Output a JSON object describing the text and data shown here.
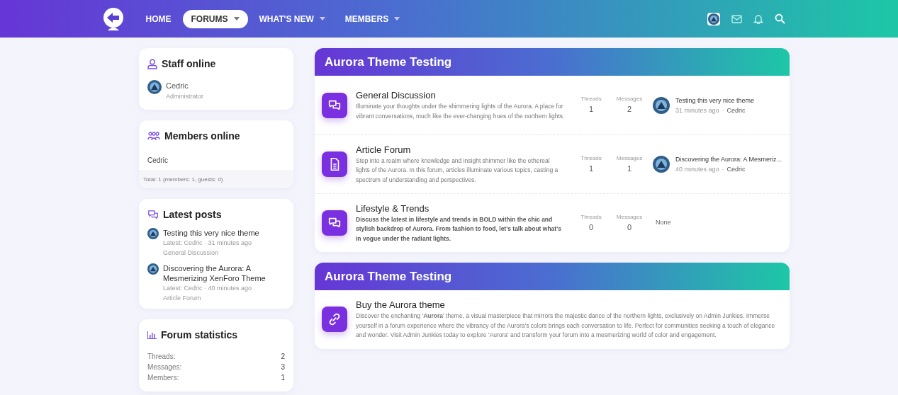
{
  "nav": {
    "items": [
      {
        "label": "HOME",
        "selected": false,
        "dropdown": false
      },
      {
        "label": "FORUMS",
        "selected": true,
        "dropdown": true
      },
      {
        "label": "WHAT'S NEW",
        "selected": false,
        "dropdown": true
      },
      {
        "label": "MEMBERS",
        "selected": false,
        "dropdown": true
      }
    ]
  },
  "sidebar": {
    "staff": {
      "title": "Staff online",
      "members": [
        {
          "name": "Cedric",
          "role": "Administrator"
        }
      ]
    },
    "online": {
      "title": "Members online",
      "names": "Cedric",
      "total": "Total: 1 (members: 1, guests: 0)"
    },
    "latest": {
      "title": "Latest posts",
      "posts": [
        {
          "title": "Testing this very nice theme",
          "meta": "Latest: Cedric · 31 minutes ago",
          "forum": "General Discussion"
        },
        {
          "title": "Discovering the Aurora: A Mesmerizing XenForo Theme",
          "meta": "Latest: Cedric · 40 minutes ago",
          "forum": "Article Forum"
        }
      ]
    },
    "stats": {
      "title": "Forum statistics",
      "rows": [
        {
          "label": "Threads:",
          "value": "2"
        },
        {
          "label": "Messages:",
          "value": "3"
        },
        {
          "label": "Members:",
          "value": "1"
        }
      ]
    }
  },
  "categories": [
    {
      "title": "Aurora Theme Testing",
      "nodes": [
        {
          "kind": "chat",
          "title": "General Discussion",
          "description": "Illuminate your thoughts under the shimmering lights of the Aurora. A place for vibrant conversations, much like the ever-changing hues of the northern lights.",
          "bold_description": false,
          "threads_label": "Threads",
          "threads": "1",
          "messages_label": "Messages",
          "messages": "2",
          "latest": {
            "title": "Testing this very nice theme",
            "time": "31 minutes ago",
            "separator": "·",
            "user": "Cedric"
          }
        },
        {
          "kind": "document",
          "title": "Article Forum",
          "description": "Step into a realm where knowledge and insight shimmer like the ethereal lights of the Aurora. In this forum, articles illuminate various topics, casting a spectrum of understanding and perspectives.",
          "bold_description": false,
          "threads_label": "Threads",
          "threads": "1",
          "messages_label": "Messages",
          "messages": "1",
          "latest": {
            "title": "Discovering the Aurora: A Mesmeriz...",
            "time": "40 minutes ago",
            "separator": "·",
            "user": "Cedric"
          }
        },
        {
          "kind": "chat",
          "title": "Lifestyle & Trends",
          "description": "Discuss the latest in lifestyle and trends in BOLD within the chic and stylish backdrop of Aurora. From fashion to food, let's talk about what's in vogue under the radiant lights.",
          "bold_description": true,
          "threads_label": "Threads",
          "threads": "0",
          "messages_label": "Messages",
          "messages": "0",
          "none": "None"
        }
      ]
    },
    {
      "title": "Aurora Theme Testing",
      "nodes": [
        {
          "kind": "link",
          "title": "Buy the Aurora theme",
          "description": "Discover the enchanting '**Aurora**' theme, a visual masterpiece that mirrors the majestic dance of the northern lights, exclusively on Admin Junkies. Immerse yourself in a forum experience where the vibrancy of the Aurora's colors brings each conversation to life. Perfect for communities seeking a touch of elegance and wonder. Visit Admin Junkies today to explore 'Aurora' and transform your forum into a mesmerizing world of color and engagement.",
          "bold_description": false
        }
      ]
    }
  ]
}
